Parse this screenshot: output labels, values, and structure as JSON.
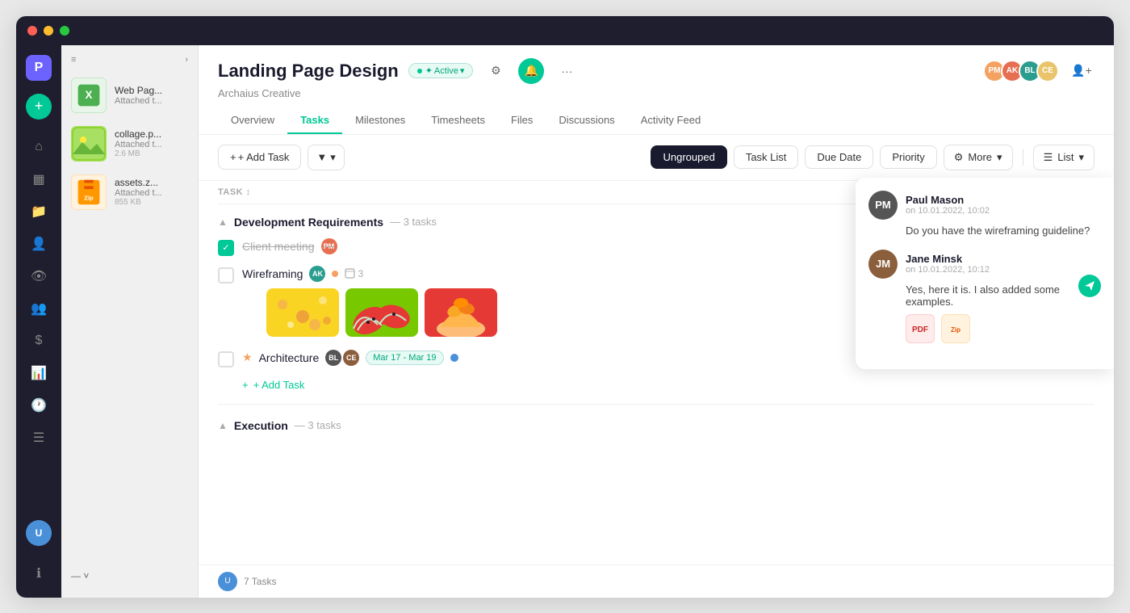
{
  "window": {
    "title": "Landing Page Design"
  },
  "titlebar": {
    "red": "#ff5f57",
    "yellow": "#ffbd2e",
    "green": "#28c940"
  },
  "sidebar": {
    "logo": "P",
    "add_label": "+",
    "nav_icons": [
      "⊞",
      "☰",
      "📁",
      "👤",
      "👁",
      "👥",
      "💲",
      "📊",
      "🕐",
      "☰"
    ],
    "items": [
      {
        "name": "home-icon",
        "icon": "⌂"
      },
      {
        "name": "dashboard-icon",
        "icon": "▦"
      },
      {
        "name": "folder-icon",
        "icon": "📁"
      },
      {
        "name": "person-icon",
        "icon": "👤"
      },
      {
        "name": "eye-icon",
        "icon": "👁"
      },
      {
        "name": "team-icon",
        "icon": "👥"
      },
      {
        "name": "billing-icon",
        "icon": "$"
      },
      {
        "name": "chart-icon",
        "icon": "📊"
      },
      {
        "name": "clock-icon",
        "icon": "🕐"
      },
      {
        "name": "list-icon",
        "icon": "☰"
      }
    ]
  },
  "files_sidebar": {
    "header_left": "≡",
    "header_right": "›",
    "files": [
      {
        "id": "file-1",
        "name": "Web Pag...",
        "sub": "Attached t...",
        "type": "excel",
        "icon_label": "X"
      },
      {
        "id": "file-2",
        "name": "collage.p...",
        "sub": "Attached t...",
        "size": "2.6 MB",
        "type": "image"
      },
      {
        "id": "file-3",
        "name": "assets.z...",
        "sub": "Attached t...",
        "size": "855 KB",
        "type": "zip",
        "icon_label": "Zip"
      }
    ]
  },
  "project": {
    "title": "Landing Page Design",
    "status": "Active",
    "company": "Archaius Creative",
    "header_icons": [
      "⚙",
      "🔔",
      "···"
    ],
    "avatars": [
      "PM",
      "AK",
      "BL",
      "CE"
    ]
  },
  "tabs": [
    {
      "id": "overview",
      "label": "Overview",
      "active": false
    },
    {
      "id": "tasks",
      "label": "Tasks",
      "active": true
    },
    {
      "id": "milestones",
      "label": "Milestones",
      "active": false
    },
    {
      "id": "timesheets",
      "label": "Timesheets",
      "active": false
    },
    {
      "id": "files",
      "label": "Files",
      "active": false
    },
    {
      "id": "discussions",
      "label": "Discussions",
      "active": false
    },
    {
      "id": "activity",
      "label": "Activity Feed",
      "active": false
    }
  ],
  "toolbar": {
    "add_task": "+ Add Task",
    "filter": "▾",
    "groups": [
      "Ungrouped",
      "Task List",
      "Due Date",
      "Priority"
    ],
    "active_group": "Ungrouped",
    "more": "More",
    "view": "List"
  },
  "task_table": {
    "col_task": "TASK ↕"
  },
  "sections": [
    {
      "id": "dev-requirements",
      "name": "Development Requirements",
      "count": "3 tasks",
      "tasks": [
        {
          "id": "task-1",
          "name": "Client meeting",
          "completed": true,
          "avatars": [
            "PM"
          ]
        },
        {
          "id": "task-2",
          "name": "Wireframing",
          "completed": false,
          "avatars": [
            "AK"
          ],
          "has_dot": true,
          "files": 3,
          "has_thumbnails": true
        },
        {
          "id": "task-3",
          "name": "Architecture",
          "completed": false,
          "priority": true,
          "avatars": [
            "BL",
            "CE"
          ],
          "date": "Mar 17 - Mar 19",
          "has_blue_dot": true
        }
      ],
      "add_task_label": "+ Add Task"
    },
    {
      "id": "execution",
      "name": "Execution",
      "count": "3 tasks",
      "tasks": []
    }
  ],
  "comments": [
    {
      "id": "comment-1",
      "author": "Paul Mason",
      "time": "on 10.01.2022, 10:02",
      "text": "Do you have the wireframing guideline?",
      "avatar_initials": "PM",
      "avatar_class": "ca1"
    },
    {
      "id": "comment-2",
      "author": "Jane Minsk",
      "time": "on 10.01.2022, 10:12",
      "text": "Yes, here it is. I also added some examples.",
      "avatar_initials": "JM",
      "avatar_class": "ca2",
      "attachments": [
        {
          "type": "pdf",
          "label": "📄"
        },
        {
          "type": "zip",
          "label": "Zip"
        }
      ]
    }
  ],
  "bottom_bar": {
    "task_count": "7 Tasks"
  },
  "colors": {
    "accent": "#00c896",
    "dark": "#1a1a2e",
    "muted": "#888888"
  }
}
